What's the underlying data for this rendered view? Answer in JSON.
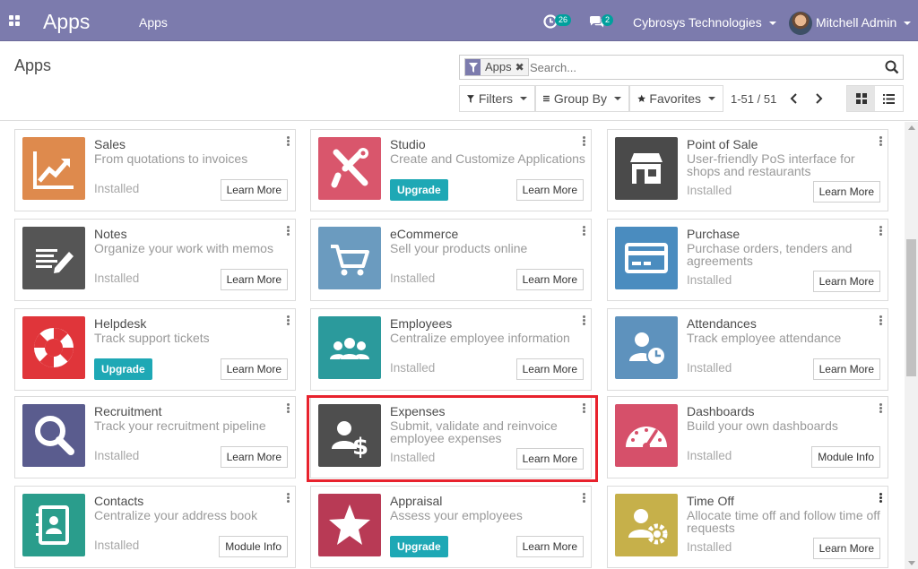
{
  "navbar": {
    "brand": "Apps",
    "menu": "Apps",
    "activity_count": "26",
    "messages_count": "2",
    "company": "Cybrosys Technologies",
    "user": "Mitchell Admin",
    "bg_color": "#7c7bad"
  },
  "control_panel": {
    "breadcrumb": "Apps",
    "search": {
      "facet": "Apps",
      "placeholder": "Search..."
    },
    "filters_label": "Filters",
    "groupby_label": "Group By",
    "favorites_label": "Favorites",
    "pager": "1-51 / 51",
    "views": [
      "kanban",
      "list"
    ]
  },
  "cards": [
    {
      "name": "Sales",
      "desc": "From quotations to invoices",
      "status": "Installed",
      "button": "Learn More",
      "color": "#de8a4d",
      "icon": "sales-chart-icon"
    },
    {
      "name": "Studio",
      "desc": "Create and Customize Applications",
      "status": "",
      "upgrade": "Upgrade",
      "button": "Learn More",
      "color": "#d9566c",
      "icon": "tools-icon"
    },
    {
      "name": "Point of Sale",
      "desc": "User-friendly PoS interface for shops and restaurants",
      "status": "Installed",
      "button": "Learn More",
      "color": "#4a4a4a",
      "icon": "shop-icon"
    },
    {
      "name": "Notes",
      "desc": "Organize your work with memos",
      "status": "Installed",
      "button": "Learn More",
      "color": "#555555",
      "icon": "note-pencil-icon"
    },
    {
      "name": "eCommerce",
      "desc": "Sell your products online",
      "status": "Installed",
      "button": "Learn More",
      "color": "#6b9bbf",
      "icon": "cart-icon"
    },
    {
      "name": "Purchase",
      "desc": "Purchase orders, tenders and agreements",
      "status": "Installed",
      "button": "Learn More",
      "color": "#4a8cbf",
      "icon": "credit-card-icon"
    },
    {
      "name": "Helpdesk",
      "desc": "Track support tickets",
      "status": "",
      "upgrade": "Upgrade",
      "button": "Learn More",
      "color": "#e0353a",
      "icon": "lifebuoy-icon"
    },
    {
      "name": "Employees",
      "desc": "Centralize employee information",
      "status": "Installed",
      "button": "Learn More",
      "color": "#2b9a9c",
      "icon": "people-icon"
    },
    {
      "name": "Attendances",
      "desc": "Track employee attendance",
      "status": "Installed",
      "button": "Learn More",
      "color": "#5e92bd",
      "icon": "person-clock-icon"
    },
    {
      "name": "Recruitment",
      "desc": "Track your recruitment pipeline",
      "status": "Installed",
      "button": "Learn More",
      "color": "#5a5c8e",
      "icon": "magnifier-icon"
    },
    {
      "name": "Expenses",
      "desc": "Submit, validate and reinvoice employee expenses",
      "status": "Installed",
      "button": "Learn More",
      "color": "#4e4e4e",
      "icon": "person-dollar-icon"
    },
    {
      "name": "Dashboards",
      "desc": "Build your own dashboards",
      "status": "Installed",
      "button": "Module Info",
      "color": "#d6506a",
      "icon": "gauge-icon"
    },
    {
      "name": "Contacts",
      "desc": "Centralize your address book",
      "status": "Installed",
      "button": "Module Info",
      "color": "#2a9d8c",
      "icon": "address-book-icon"
    },
    {
      "name": "Appraisal",
      "desc": "Assess your employees",
      "status": "",
      "upgrade": "Upgrade",
      "button": "Learn More",
      "color": "#b83a55",
      "icon": "star-icon"
    },
    {
      "name": "Time Off",
      "desc": "Allocate time off and follow time off requests",
      "status": "Installed",
      "button": "Learn More",
      "color": "#c6b04a",
      "icon": "person-gear-icon"
    }
  ],
  "colors": {
    "accent": "#7c7bad",
    "upgrade": "#1ea8b5",
    "highlight": "#e8222d"
  }
}
